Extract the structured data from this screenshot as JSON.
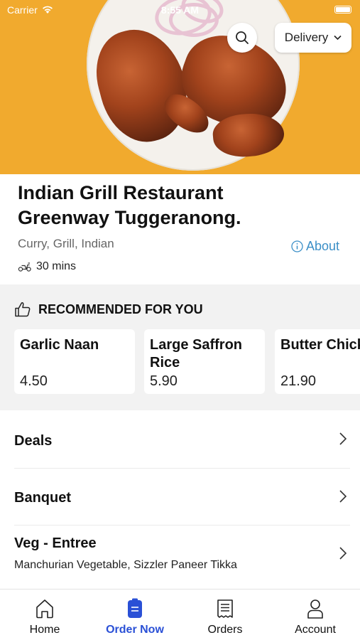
{
  "status_bar": {
    "carrier": "Carrier",
    "time": "8:55 AM"
  },
  "hero": {
    "delivery_label": "Delivery",
    "icons": {
      "search": "search-icon",
      "dropdown": "chevron-down-icon"
    },
    "colors": {
      "background": "#f1aa2e"
    }
  },
  "restaurant": {
    "name_line1": "Indian Grill Restaurant",
    "name_line2": "Greenway Tuggeranong.",
    "cuisines": "Curry, Grill, Indian",
    "about_label": "About",
    "eta": "30 mins"
  },
  "recommended": {
    "header": "RECOMMENDED FOR YOU",
    "items": [
      {
        "name_line1": "Garlic Naan",
        "name_line2": "",
        "price": "4.50"
      },
      {
        "name_line1": "Large Saffron",
        "name_line2": "Rice",
        "price": "5.90"
      },
      {
        "name_line1": "Butter Chicken",
        "name_line2": "",
        "price": "21.90"
      }
    ]
  },
  "menu": {
    "categories": [
      {
        "label": "Deals",
        "subtitle": ""
      },
      {
        "label": "Banquet",
        "subtitle": ""
      },
      {
        "label": "Veg - Entree",
        "subtitle": "Manchurian Vegetable, Sizzler Paneer Tikka"
      }
    ]
  },
  "tabbar": {
    "active_color": "#2a50d6",
    "tabs": [
      {
        "label": "Home",
        "icon": "home-icon"
      },
      {
        "label": "Order Now",
        "icon": "order-icon"
      },
      {
        "label": "Orders",
        "icon": "receipt-icon"
      },
      {
        "label": "Account",
        "icon": "person-icon"
      }
    ]
  }
}
